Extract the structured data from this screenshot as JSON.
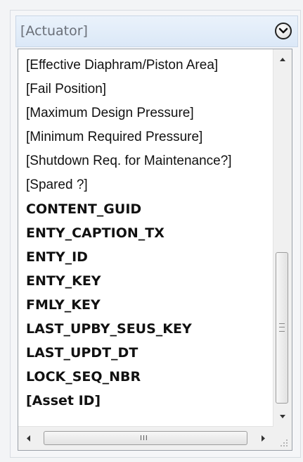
{
  "header": {
    "title": "[Actuator]",
    "toggle_icon": "chevron-down-circle-icon"
  },
  "list": {
    "items": [
      {
        "label": "[Effective Diaphram/Piston Area]",
        "bold": false
      },
      {
        "label": "[Fail Position]",
        "bold": false
      },
      {
        "label": "[Maximum Design Pressure]",
        "bold": false
      },
      {
        "label": "[Minimum Required Pressure]",
        "bold": false
      },
      {
        "label": "[Shutdown Req. for Maintenance?]",
        "bold": false
      },
      {
        "label": "[Spared ?]",
        "bold": false
      },
      {
        "label": "CONTENT_GUID",
        "bold": true
      },
      {
        "label": "ENTY_CAPTION_TX",
        "bold": true
      },
      {
        "label": "ENTY_ID",
        "bold": true
      },
      {
        "label": "ENTY_KEY",
        "bold": true
      },
      {
        "label": "FMLY_KEY",
        "bold": true
      },
      {
        "label": "LAST_UPBY_SEUS_KEY",
        "bold": true
      },
      {
        "label": "LAST_UPDT_DT",
        "bold": true
      },
      {
        "label": "LOCK_SEQ_NBR",
        "bold": true
      },
      {
        "label": "[Asset ID]",
        "bold": true
      }
    ]
  },
  "scrollbars": {
    "vertical_icons": [
      "scroll-up-icon",
      "scroll-down-icon"
    ],
    "horizontal_icons": [
      "scroll-left-icon",
      "scroll-right-icon"
    ]
  }
}
